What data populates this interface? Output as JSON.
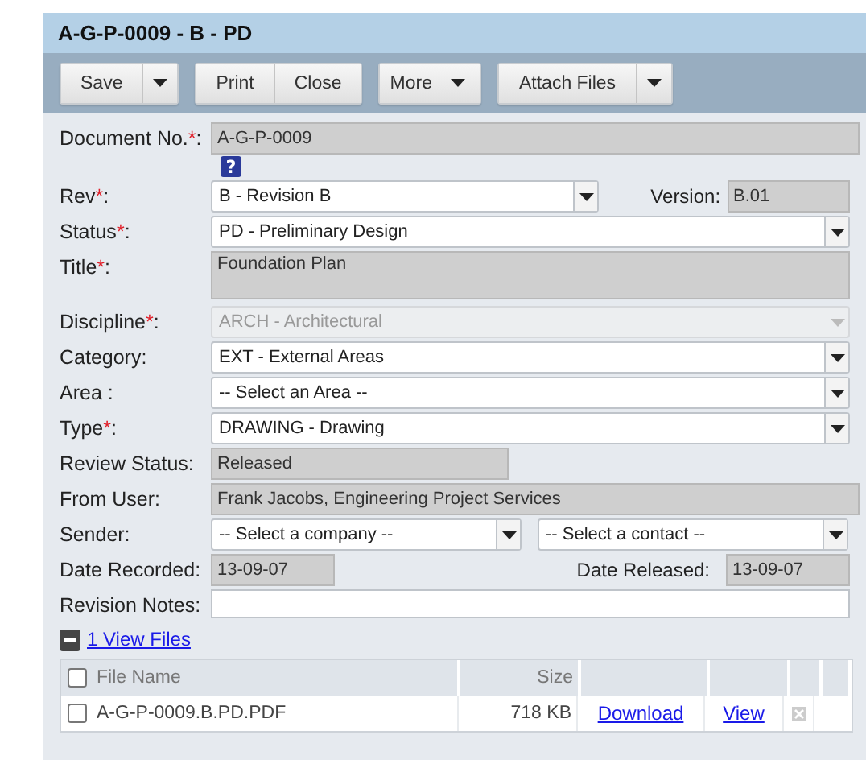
{
  "window": {
    "title": "A-G-P-0009 - B - PD"
  },
  "toolbar": [
    {
      "items": [
        {
          "kind": "text",
          "label": "Save"
        },
        {
          "kind": "split"
        }
      ]
    },
    {
      "items": [
        {
          "kind": "text",
          "label": "Print"
        },
        {
          "kind": "text",
          "label": "Close"
        }
      ]
    },
    {
      "items": [
        {
          "kind": "menu",
          "label": "More"
        }
      ]
    },
    {
      "items": [
        {
          "kind": "text",
          "label": "Attach Files"
        },
        {
          "kind": "split"
        }
      ]
    }
  ],
  "fields": [
    {
      "kind": "readonly-help",
      "label": "Document No.",
      "mark": "*",
      "tail": ":",
      "value": "A-G-P-0009",
      "help": "?"
    },
    {
      "kind": "select-version",
      "label": "Rev",
      "mark": "*",
      "tail": ":",
      "value": "B - Revision B",
      "disabled": false,
      "version_label": "Version:",
      "version_value": "B.01"
    },
    {
      "kind": "select",
      "label": "Status",
      "mark": "*",
      "tail": ":",
      "value": "PD - Preliminary Design",
      "disabled": false
    },
    {
      "kind": "textarea",
      "label": "Title",
      "mark": "*",
      "tail": ":",
      "value": "Foundation Plan"
    },
    {
      "kind": "select",
      "label": "Discipline",
      "mark": "*",
      "tail": ":",
      "value": "ARCH - Architectural",
      "disabled": true
    },
    {
      "kind": "select",
      "label": "Category:",
      "value": "EXT - External Areas",
      "disabled": false
    },
    {
      "kind": "select",
      "label": "Area :",
      "value": "-- Select an Area --",
      "disabled": false
    },
    {
      "kind": "select",
      "label": "Type",
      "mark": "*",
      "tail": ":",
      "value": "DRAWING - Drawing",
      "disabled": false
    },
    {
      "kind": "readonly-short",
      "label": "Review Status:",
      "value": "Released"
    },
    {
      "kind": "readonly",
      "label": "From User:",
      "value": "Frank Jacobs, Engineering Project Services"
    },
    {
      "kind": "select-pair",
      "label": "Sender:",
      "values": [
        "-- Select a company --",
        "-- Select a contact --"
      ]
    },
    {
      "kind": "date-pair",
      "label": "Date Recorded:",
      "value": "13-09-07",
      "second_label": "Date Released:",
      "second_value": "13-09-07"
    },
    {
      "kind": "text",
      "label": "Revision Notes:"
    }
  ],
  "files": {
    "expanded": true,
    "link": "1 View Files",
    "header": {
      "checked": false,
      "columns": [
        "File Name",
        "Size"
      ]
    },
    "rows": [
      {
        "checked": false,
        "name": "A-G-P-0009.B.PD.PDF",
        "size": "718 KB",
        "download": "Download",
        "view": "View"
      }
    ]
  }
}
